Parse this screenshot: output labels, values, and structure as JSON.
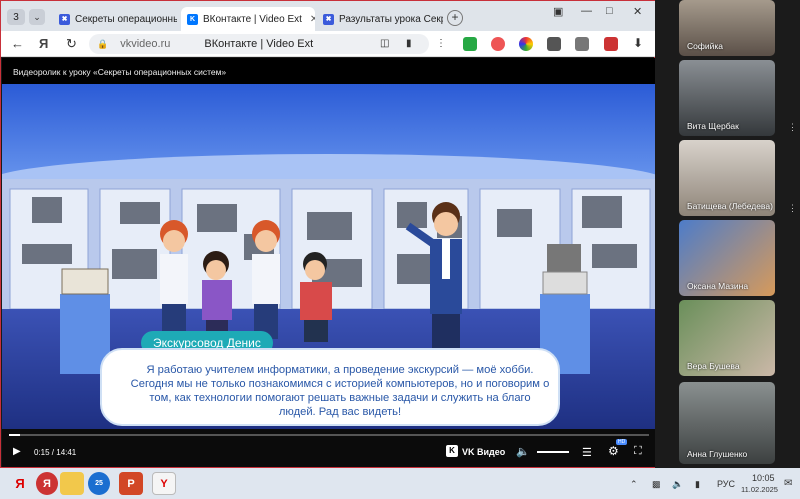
{
  "browser": {
    "tab_count": "3",
    "tabs": [
      {
        "label": "Секреты операционных с"
      },
      {
        "label": "ВКонтакте | Video Ext"
      },
      {
        "label": "Разультаты урока Секрет"
      }
    ],
    "address": {
      "url": "vkvideo.ru",
      "page_title": "ВКонтакте | Video Ext"
    }
  },
  "video": {
    "header_title": "Видеоролик к уроку «Секреты операционных систем»",
    "speaker_name": "Экскурсовод Денис",
    "subtitle": "Я работаю учителем информатики, а проведение экскурсий — моё хобби. Сегодня мы не только познакомимся с историей компьютеров, но и поговорим о том, как технологии помогают решать важные задачи и служить на благо людей. Рад вас видеть!",
    "time": "0:15 / 14:41",
    "progress": 0.017,
    "brand": "VK Видео",
    "quality_badge": "HD"
  },
  "participants": [
    {
      "name": "Софийка"
    },
    {
      "name": "Вита Щербак"
    },
    {
      "name": "Батищева (Лебедева)"
    },
    {
      "name": "Оксана Мазина"
    },
    {
      "name": "Вера Бушева"
    },
    {
      "name": "Анна Глушенко"
    }
  ],
  "taskbar": {
    "powerpoint_badge": "25",
    "tray_lang": "РУС",
    "time": "10:05",
    "date": "11.02.2025"
  },
  "colors": {
    "accent": "#1eaab6",
    "vk": "#0077ff",
    "frame": "#c8303a"
  }
}
